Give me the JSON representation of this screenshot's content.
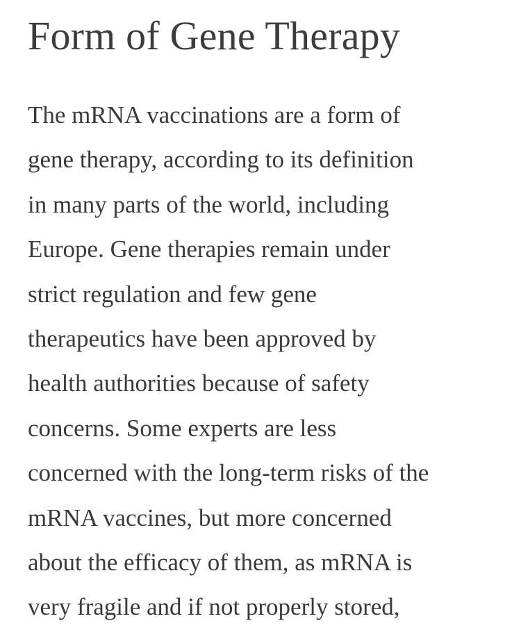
{
  "article": {
    "title": "Form of Gene Therapy",
    "body_lines": [
      "The mRNA vaccinations are a form of",
      "gene therapy, according to its definition",
      "in many parts of the world, including",
      "Europe. Gene therapies remain under",
      "strict regulation and few gene",
      "therapeutics have been approved by",
      "health authorities because of safety",
      "concerns. Some experts are less",
      "concerned with the long-term risks of the",
      "mRNA vaccines, but more concerned",
      "about the efficacy of them, as mRNA is",
      "very fragile and if not properly stored,"
    ]
  }
}
